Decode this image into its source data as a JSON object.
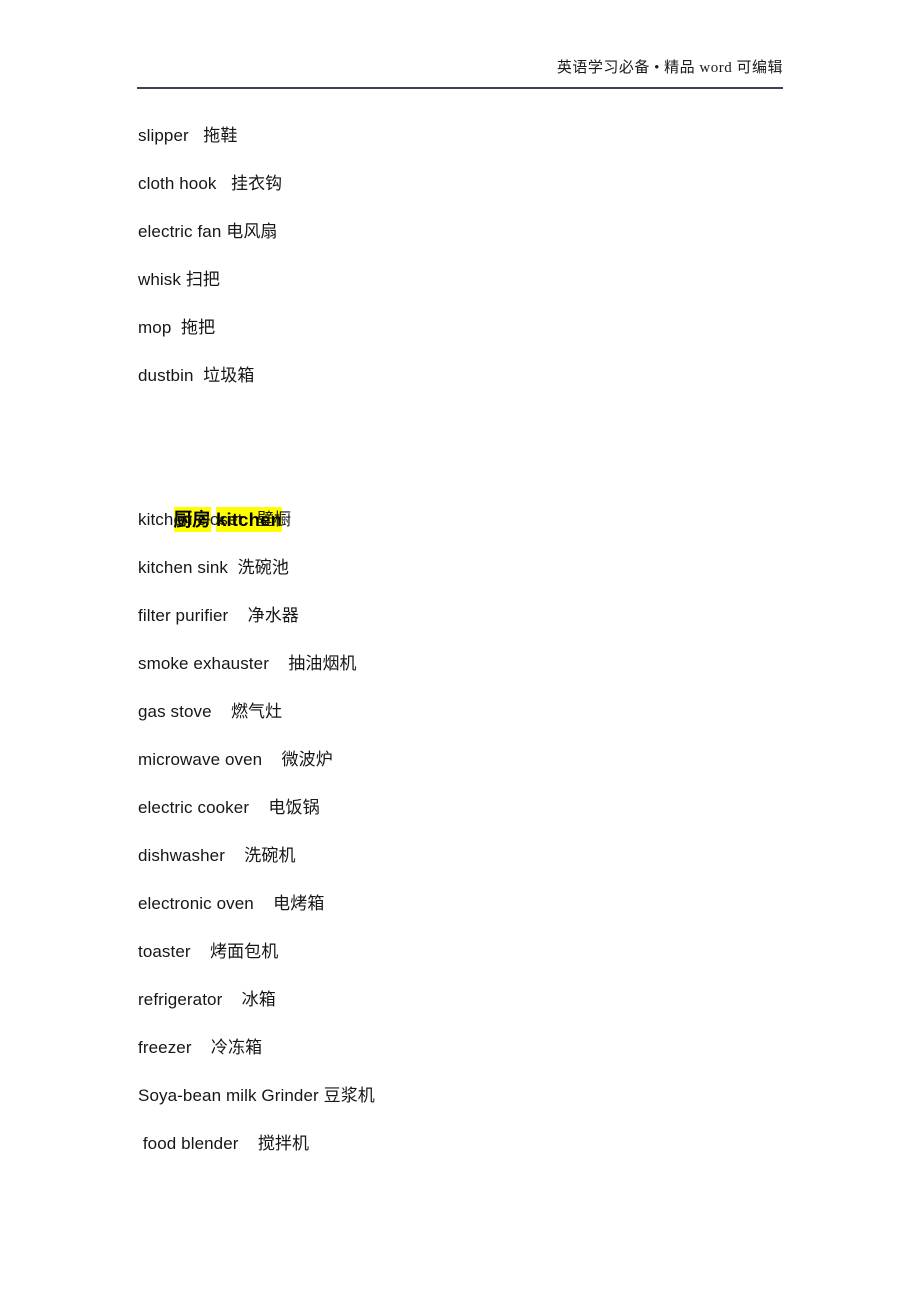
{
  "header": {
    "text": "英语学习必备 • 精品 word 可编辑",
    "rule_color": "#41424e"
  },
  "colors": {
    "highlight": "#FFFF00",
    "text": "#161616",
    "page_background": "#ffffff"
  },
  "sections": [
    {
      "heading": null,
      "entries": [
        {
          "english": "slipper",
          "chinese": "拖鞋",
          "line": "slipper   拖鞋"
        },
        {
          "english": "cloth hook",
          "chinese": "挂衣钩",
          "line": "cloth hook   挂衣钩"
        },
        {
          "english": "electric fan",
          "chinese": "电风扇",
          "line": "electric fan 电风扇"
        },
        {
          "english": "whisk",
          "chinese": "扫把",
          "line": "whisk 扫把"
        },
        {
          "english": "mop",
          "chinese": "拖把",
          "line": "mop  拖把"
        },
        {
          "english": "dustbin",
          "chinese": "垃圾箱",
          "line": "dustbin  垃圾箱"
        }
      ]
    },
    {
      "heading": {
        "chinese": "厨房",
        "english": "kitchen",
        "highlighted": true
      },
      "entries": [
        {
          "english": "kitchen closet",
          "chinese": "壁橱",
          "line": "kitchen closet   壁橱"
        },
        {
          "english": "kitchen sink",
          "chinese": "洗碗池",
          "line": "kitchen sink  洗碗池"
        },
        {
          "english": "filter purifier",
          "chinese": "净水器",
          "line": "filter purifier    净水器"
        },
        {
          "english": "smoke exhauster",
          "chinese": "抽油烟机",
          "line": "smoke exhauster    抽油烟机"
        },
        {
          "english": "gas stove",
          "chinese": "燃气灶",
          "line": "gas stove    燃气灶"
        },
        {
          "english": "microwave oven",
          "chinese": "微波炉",
          "line": "microwave oven    微波炉"
        },
        {
          "english": "electric cooker",
          "chinese": "电饭锅",
          "line": "electric cooker    电饭锅"
        },
        {
          "english": "dishwasher",
          "chinese": "洗碗机",
          "line": "dishwasher    洗碗机"
        },
        {
          "english": "electronic oven",
          "chinese": "电烤箱",
          "line": "electronic oven    电烤箱"
        },
        {
          "english": "toaster",
          "chinese": "烤面包机",
          "line": "toaster    烤面包机"
        },
        {
          "english": "refrigerator",
          "chinese": "冰箱",
          "line": "refrigerator    冰箱"
        },
        {
          "english": "freezer",
          "chinese": "冷冻箱",
          "line": "freezer    冷冻箱"
        },
        {
          "english": "Soya-bean milk Grinder",
          "chinese": "豆浆机",
          "line": "Soya-bean milk Grinder 豆浆机"
        },
        {
          "english": "food blender",
          "chinese": "搅拌机",
          "line": " food blender    搅拌机"
        }
      ]
    }
  ]
}
